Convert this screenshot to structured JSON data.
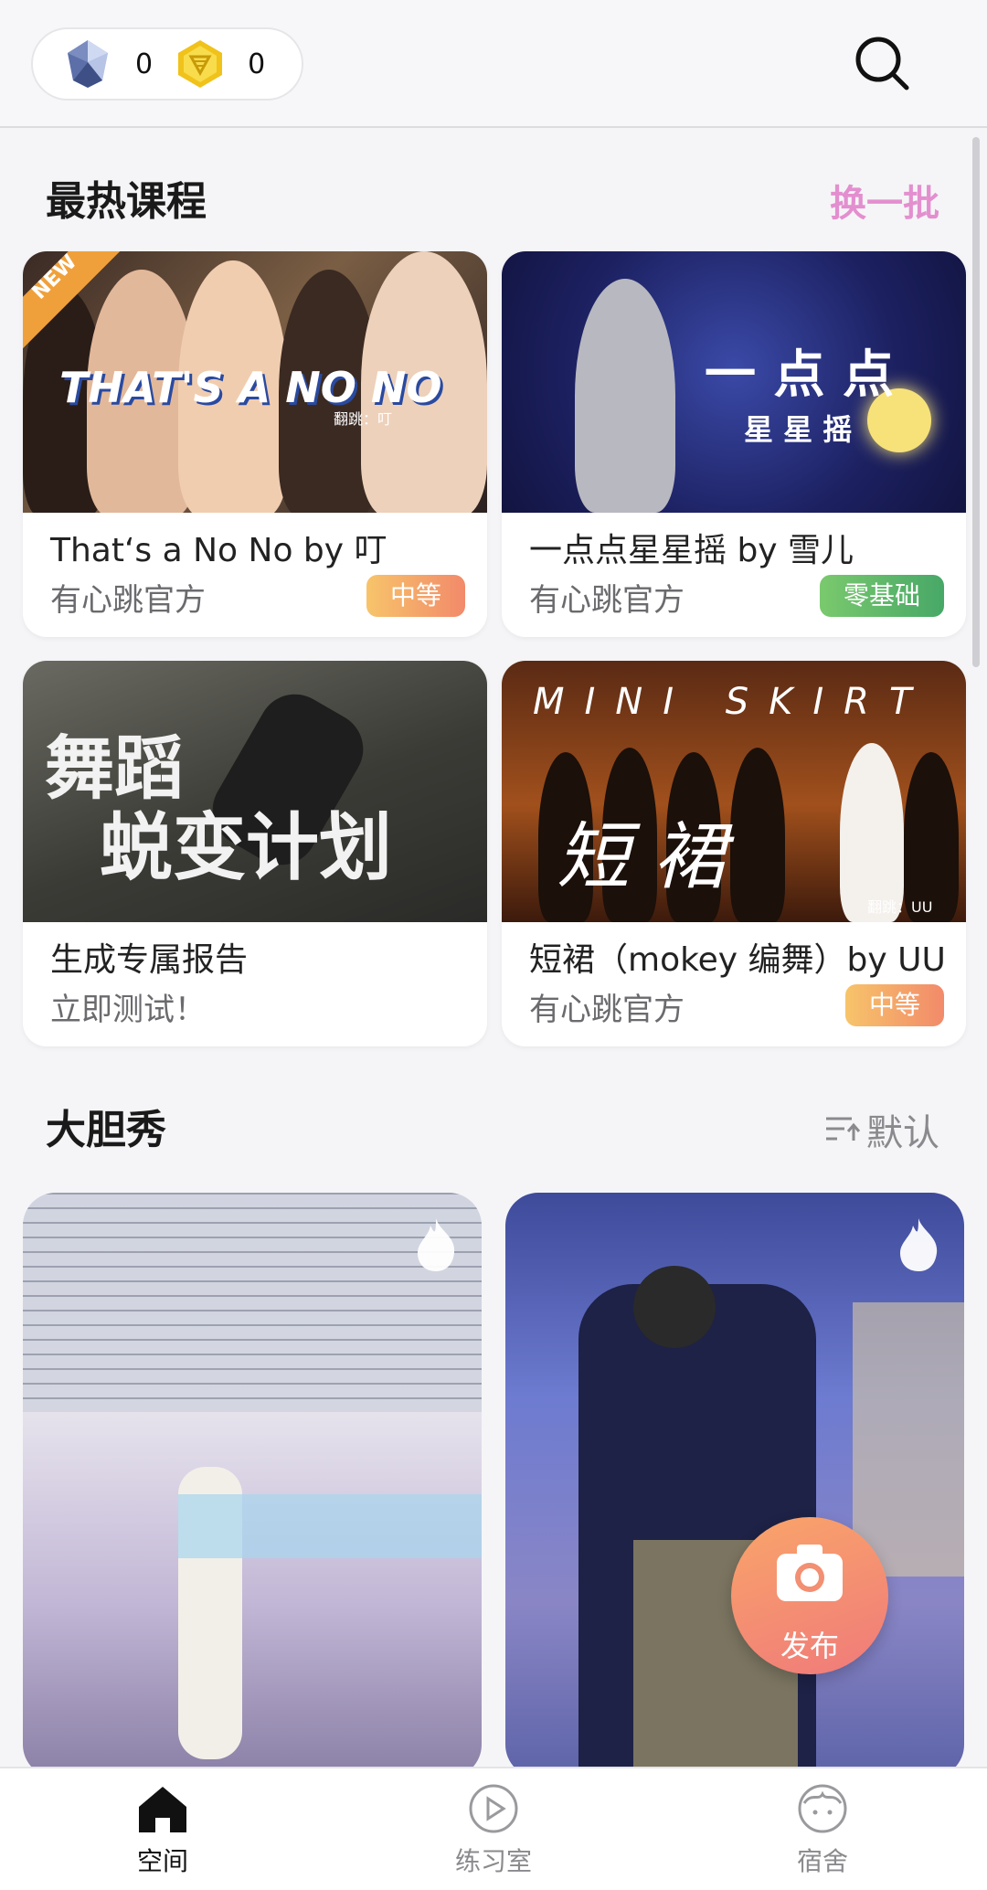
{
  "header": {
    "diamonds": "0",
    "coins": "0",
    "diamond_icon": "diamond-icon",
    "coin_icon": "coin-icon",
    "search_icon": "search-icon"
  },
  "hot_courses": {
    "title": "最热课程",
    "refresh_label": "换一批",
    "cards": [
      {
        "title": "That‘s a No No by 叮",
        "subtitle": "有心跳官方",
        "badge": "中等",
        "badge_color": "#f28a6a",
        "thumb_text": "THAT'S A NO NO",
        "thumb_tag": "NEW",
        "thumb_credit": "翻跳：叮"
      },
      {
        "title": "一点点星星摇 by 雪儿",
        "subtitle": "有心跳官方",
        "badge": "零基础",
        "badge_color": "#47a867",
        "thumb_text_1": "一 点 点",
        "thumb_text_2": "星 星 摇"
      },
      {
        "title": "生成专属报告",
        "subtitle": "立即测试！",
        "thumb_text_1": "舞蹈",
        "thumb_text_2": "蜕变计划"
      },
      {
        "title": "短裙（mokey 编舞）by UU",
        "subtitle": "有心跳官方",
        "badge": "中等",
        "badge_color": "#f28a6a",
        "thumb_text_1": "MINI SKIRT",
        "thumb_text_2": "短  裙",
        "thumb_credit": "翻跳：UU"
      }
    ]
  },
  "bold_show": {
    "title": "大胆秀",
    "sort_label": "默认",
    "sort_icon": "sort-icon",
    "flame_icon": "flame-icon"
  },
  "fab": {
    "label": "发布",
    "icon": "camera-icon"
  },
  "bottom_nav": {
    "items": [
      {
        "label": "空间",
        "icon": "home-icon",
        "active": true
      },
      {
        "label": "练习室",
        "icon": "play-icon",
        "active": false
      },
      {
        "label": "宿舍",
        "icon": "face-icon",
        "active": false
      }
    ]
  },
  "colors": {
    "accent_pink": "#e38fcf",
    "badge_mid": "#f28a6a",
    "badge_zero": "#47a867"
  }
}
